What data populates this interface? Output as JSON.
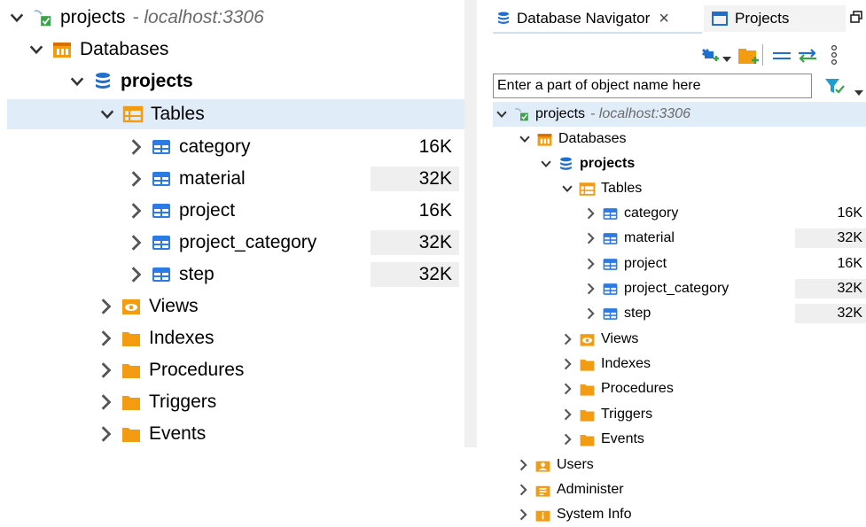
{
  "left_tree": {
    "connection": {
      "label": "projects",
      "host": "- localhost:3306"
    },
    "databases_label": "Databases",
    "database": {
      "label": "projects"
    },
    "tables_label": "Tables",
    "tables": [
      {
        "name": "category",
        "size": "16K",
        "shaded": false
      },
      {
        "name": "material",
        "size": "32K",
        "shaded": true
      },
      {
        "name": "project",
        "size": "16K",
        "shaded": false
      },
      {
        "name": "project_category",
        "size": "32K",
        "shaded": true
      },
      {
        "name": "step",
        "size": "32K",
        "shaded": true
      }
    ],
    "folders": [
      "Views",
      "Indexes",
      "Procedures",
      "Triggers",
      "Events"
    ]
  },
  "right_panel": {
    "tabs": [
      {
        "label": "Database Navigator",
        "close": "×"
      },
      {
        "label": "Projects"
      }
    ],
    "filter_placeholder": "Enter a part of object name here",
    "connection": {
      "label": "projects",
      "host": "- localhost:3306"
    },
    "databases_label": "Databases",
    "database": {
      "label": "projects"
    },
    "tables_label": "Tables",
    "tables": [
      {
        "name": "category",
        "size": "16K",
        "shaded": false
      },
      {
        "name": "material",
        "size": "32K",
        "shaded": true
      },
      {
        "name": "project",
        "size": "16K",
        "shaded": false
      },
      {
        "name": "project_category",
        "size": "32K",
        "shaded": true
      },
      {
        "name": "step",
        "size": "32K",
        "shaded": true
      }
    ],
    "folders": [
      "Views",
      "Indexes",
      "Procedures",
      "Triggers",
      "Events"
    ],
    "root_items": [
      "Users",
      "Administer",
      "System Info"
    ]
  },
  "colors": {
    "accent": "#1f6fd1",
    "folder": "#f39c12",
    "selection": "#e1ecf9",
    "table_icon": "#2c7be5"
  }
}
